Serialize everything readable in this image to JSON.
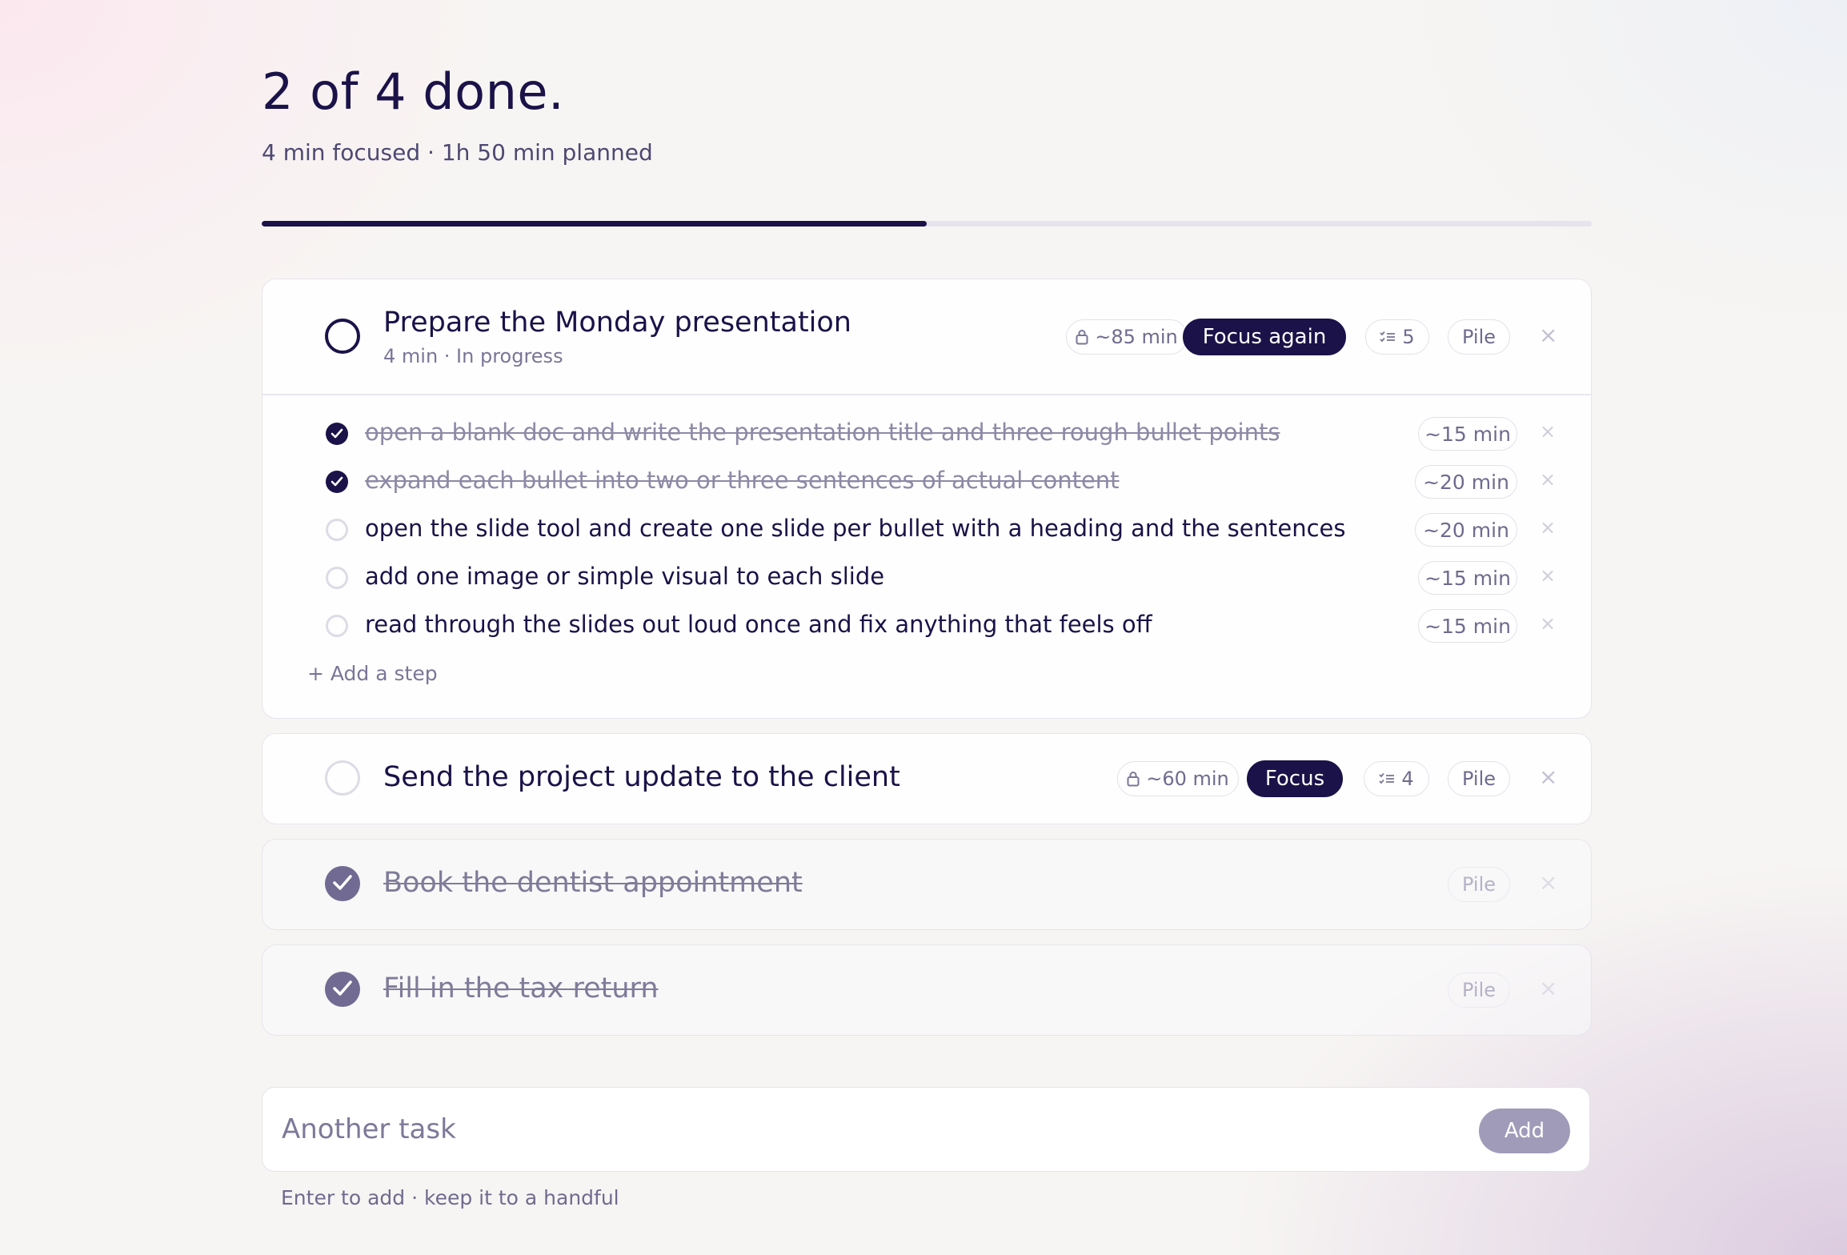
{
  "header": {
    "headline": "2 of 4 done.",
    "summary": "4 min focused · 1h 50 min planned",
    "progress_fraction": 0.5
  },
  "tasks": [
    {
      "title": "Prepare the Monday presentation",
      "meta": "4 min · In progress",
      "estimate": "~85 min",
      "focus_label": "Focus again",
      "steps_count": "5",
      "pile_label": "Pile",
      "steps": [
        {
          "text": "open a blank doc and write the presentation title and three rough bullet points",
          "estimate": "~15 min",
          "done": true
        },
        {
          "text": "expand each bullet into two or three sentences of actual content",
          "estimate": "~20 min",
          "done": true
        },
        {
          "text": "open the slide tool and create one slide per bullet with a heading and the sentences",
          "estimate": "~20 min",
          "done": false
        },
        {
          "text": "add one image or simple visual to each slide",
          "estimate": "~15 min",
          "done": false
        },
        {
          "text": "read through the slides out loud once and fix anything that feels off",
          "estimate": "~15 min",
          "done": false
        }
      ],
      "add_step_label": "+ Add a step"
    },
    {
      "title": "Send the project update to the client",
      "estimate": "~60 min",
      "focus_label": "Focus",
      "steps_count": "4",
      "pile_label": "Pile"
    },
    {
      "title": "Book the dentist appointment",
      "pile_label": "Pile",
      "done": true
    },
    {
      "title": "Fill in the tax return",
      "pile_label": "Pile",
      "done": true
    }
  ],
  "composer": {
    "placeholder": "Another task",
    "add_label": "Add",
    "hint": "Enter to add · keep it to a handful"
  },
  "icons": {
    "close": "×",
    "lock": "lock-icon",
    "steps": "checklist-icon",
    "check": "check-icon"
  },
  "colors": {
    "primary": "#1a1248",
    "muted": "#7a7697",
    "done_check": "#716b93"
  }
}
